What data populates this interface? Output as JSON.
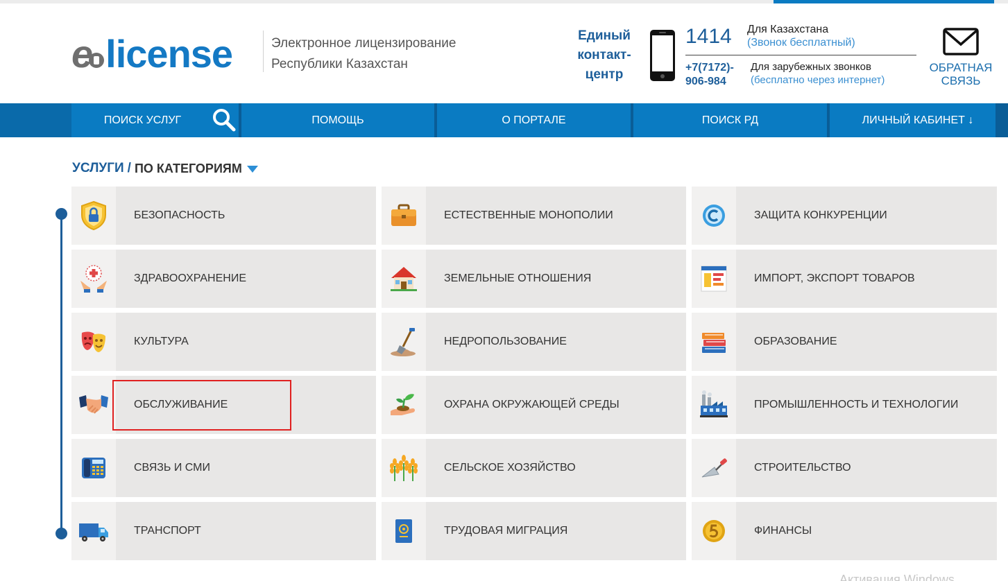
{
  "header": {
    "logo_e": "e",
    "logo_text": "license",
    "subtitle_line1": "Электронное лицензирование",
    "subtitle_line2": "Республики Казахстан",
    "contact_center": [
      "Единый",
      "контакт-",
      "центр"
    ],
    "phone_kz": "1414",
    "phone_kz_label": "Для Казахстана",
    "phone_kz_sub": "(Звонок бесплатный)",
    "phone_intl_line1": "+7(7172)-",
    "phone_intl_line2": "906-984",
    "phone_intl_label": "Для зарубежных звонков",
    "phone_intl_sub": "(бесплатно через интернет)",
    "feedback_line1": "ОБРАТНАЯ",
    "feedback_line2": "СВЯЗЬ"
  },
  "nav": {
    "items": [
      {
        "label": "ПОИСК УСЛУГ",
        "icon": "search-icon"
      },
      {
        "label": "ПОМОЩЬ"
      },
      {
        "label": "О ПОРТАЛЕ"
      },
      {
        "label": "ПОИСК РД"
      },
      {
        "label": "ЛИЧНЫЙ КАБИНЕТ ↓"
      }
    ]
  },
  "breadcrumb": {
    "main": "УСЛУГИ",
    "separator": "/",
    "sub": "ПО КАТЕГОРИЯМ"
  },
  "categories": [
    {
      "label": "БЕЗОПАСНОСТЬ",
      "icon": "shield-lock-icon"
    },
    {
      "label": "ЕСТЕСТВЕННЫЕ МОНОПОЛИИ",
      "icon": "briefcase-icon"
    },
    {
      "label": "ЗАЩИТА КОНКУРЕНЦИИ",
      "icon": "copyright-icon"
    },
    {
      "label": "ЗДРАВООХРАНЕНИЕ",
      "icon": "hands-cross-icon"
    },
    {
      "label": "ЗЕМЕЛЬНЫЕ ОТНОШЕНИЯ",
      "icon": "house-icon"
    },
    {
      "label": "ИМПОРТ, ЭКСПОРТ ТОВАРОВ",
      "icon": "document-chart-icon"
    },
    {
      "label": "КУЛЬТУРА",
      "icon": "theater-masks-icon"
    },
    {
      "label": "НЕДРОПОЛЬЗОВАНИЕ",
      "icon": "shovel-icon"
    },
    {
      "label": "ОБРАЗОВАНИЕ",
      "icon": "books-icon"
    },
    {
      "label": "ОБСЛУЖИВАНИЕ",
      "icon": "handshake-icon"
    },
    {
      "label": "ОХРАНА ОКРУЖАЮЩЕЙ СРЕДЫ",
      "icon": "sprout-hand-icon"
    },
    {
      "label": "ПРОМЫШЛЕННОСТЬ И ТЕХНОЛОГИИ",
      "icon": "factory-icon"
    },
    {
      "label": "СВЯЗЬ И СМИ",
      "icon": "telephone-icon"
    },
    {
      "label": "СЕЛЬСКОЕ ХОЗЯЙСТВО",
      "icon": "wheat-icon"
    },
    {
      "label": "СТРОИТЕЛЬСТВО",
      "icon": "trowel-icon"
    },
    {
      "label": "ТРАНСПОРТ",
      "icon": "truck-icon"
    },
    {
      "label": "ТРУДОВАЯ МИГРАЦИЯ",
      "icon": "passport-icon"
    },
    {
      "label": "ФИНАНСЫ",
      "icon": "coin-icon"
    }
  ],
  "watermark": "Активация Windows"
}
